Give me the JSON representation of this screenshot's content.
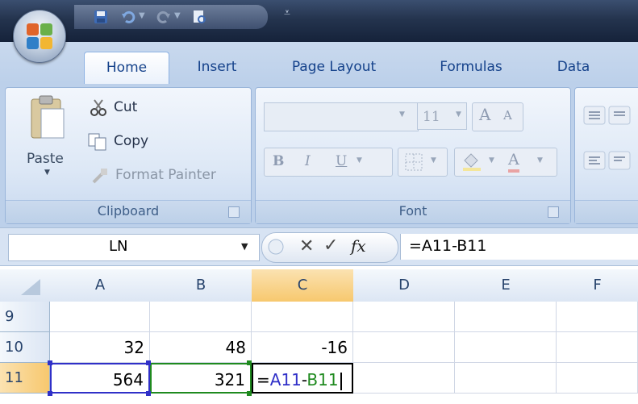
{
  "ribbon": {
    "tabs": [
      "Home",
      "Insert",
      "Page Layout",
      "Formulas",
      "Data"
    ],
    "clipboard": {
      "paste_label": "Paste",
      "cut_label": "Cut",
      "copy_label": "Copy",
      "format_painter_label": "Format Painter",
      "group_label": "Clipboard"
    },
    "font": {
      "font_name": "",
      "font_size": "11",
      "bold_label": "B",
      "italic_label": "I",
      "underline_label": "U",
      "grow_label": "A",
      "shrink_label": "A",
      "font_color_label": "A",
      "group_label": "Font"
    }
  },
  "formula_bar": {
    "name_box": "LN",
    "cancel_glyph": "✕",
    "enter_glyph": "✓",
    "fx_label": "fx",
    "formula": "=A11-B11"
  },
  "sheet": {
    "columns": [
      "A",
      "B",
      "C",
      "D",
      "E",
      "F"
    ],
    "rows": [
      "9",
      "10",
      "11"
    ],
    "cells": {
      "A10": "32",
      "B10": "48",
      "C10": "-16",
      "A11": "564",
      "B11": "321"
    },
    "editing_cell": {
      "eq": "=",
      "ref1": "A11",
      "op": "-",
      "ref2": "B11"
    }
  },
  "colors": {
    "ref1_color": "#3030c8",
    "ref2_color": "#1f8a1f",
    "ribbon_text": "#15428b",
    "active_header": "#f7c86e"
  }
}
